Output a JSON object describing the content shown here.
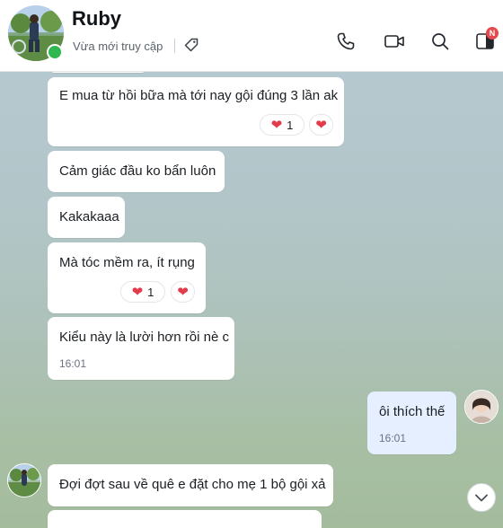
{
  "header": {
    "name": "Ruby",
    "status": "Vừa mới truy cập",
    "icons": [
      "phone-icon",
      "video-call-icon",
      "search-icon",
      "sidebar-toggle-icon"
    ],
    "badge": "N"
  },
  "colors": {
    "online": "#2fb84f",
    "my_bubble": "#e5efff",
    "their_bubble": "#ffffff",
    "heart": "#e33b4a",
    "badge": "#e5484d"
  },
  "messages": [
    {
      "sender": "them",
      "text": "E mua từ hồi bữa mà tới nay gội đúng 3 lần ak",
      "reaction": {
        "emoji": "❤",
        "count": "1"
      },
      "react_button": "❤"
    },
    {
      "sender": "them",
      "text": "Cảm giác đầu ko bẩn luôn"
    },
    {
      "sender": "them",
      "text": "Kakakaaa"
    },
    {
      "sender": "them",
      "text": "Mà tóc mềm ra, ít rụng",
      "reaction": {
        "emoji": "❤",
        "count": "1"
      },
      "react_button": "❤"
    },
    {
      "sender": "them",
      "text": "Kiểu này là lười hơn rồi nè c",
      "time": "16:01"
    },
    {
      "sender": "me",
      "text": "ôi thích thế",
      "time": "16:01"
    },
    {
      "sender": "them",
      "text": "Đợi đợt sau về quê e đặt cho mẹ 1 bộ gội xả"
    }
  ]
}
